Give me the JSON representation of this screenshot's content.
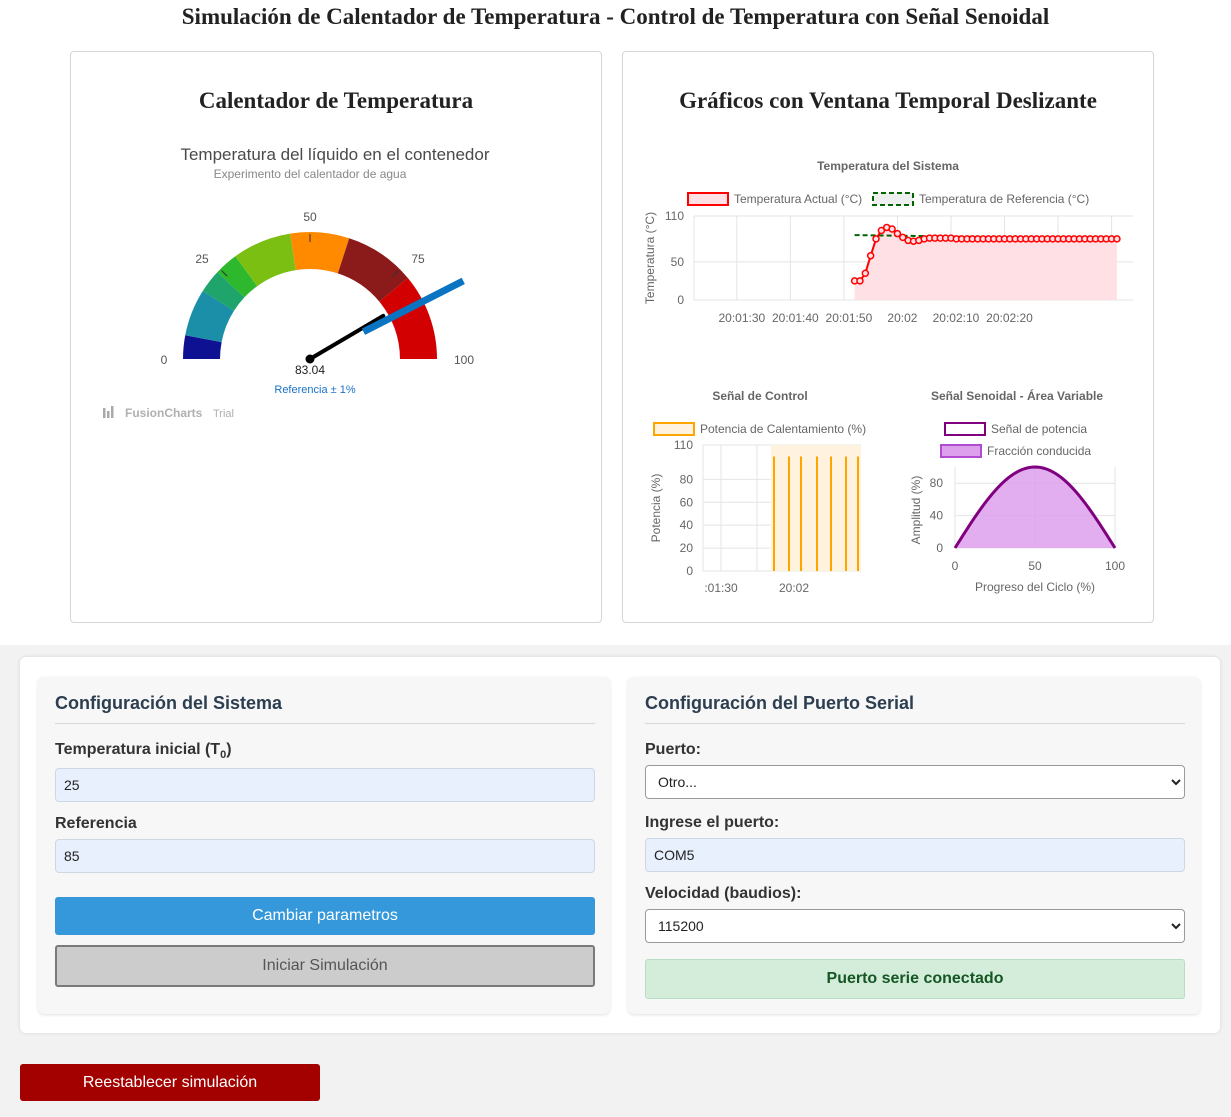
{
  "page": {
    "title": "Simulación de Calentador de Temperatura - Control de Temperatura con Señal Senoidal"
  },
  "left_card": {
    "title": "Calentador de Temperatura",
    "gauge": {
      "caption": "Temperatura del líquido en el contenedor",
      "subcaption": "Experimento del calentador de agua",
      "value": 83.04,
      "value_text": "83.04",
      "reference": 85,
      "reference_text": "Referencia ± 1%",
      "lower_limit": 0,
      "upper_limit": 100,
      "tick_labels": [
        "0",
        "25",
        "50",
        "75",
        "100"
      ],
      "color_bands": [
        {
          "from": 0,
          "to": 6,
          "color": "#0d1192"
        },
        {
          "from": 6,
          "to": 18,
          "color": "#1b8fa8"
        },
        {
          "from": 18,
          "to": 24,
          "color": "#1fa46c"
        },
        {
          "from": 24,
          "to": 30,
          "color": "#2eb82e"
        },
        {
          "from": 30,
          "to": 45,
          "color": "#7cbf13"
        },
        {
          "from": 45,
          "to": 60,
          "color": "#ff8a00"
        },
        {
          "from": 60,
          "to": 78,
          "color": "#8b1a1a"
        },
        {
          "from": 78,
          "to": 100,
          "color": "#d20000"
        }
      ],
      "needle_color": "#000000",
      "reference_marker_color": "#0a74c2",
      "watermark": "FusionCharts",
      "watermark_suffix": "Trial"
    }
  },
  "right_card": {
    "title": "Gráficos con Ventana Temporal Deslizante"
  },
  "chart_data": [
    {
      "type": "line",
      "title": "Temperatura del Sistema",
      "ylabel": "Temperatura (°C)",
      "xlabel": "",
      "ylim": [
        0,
        110
      ],
      "yticks": [
        0,
        50,
        110
      ],
      "x_ticks": [
        "20:01:30",
        "20:01:40",
        "20:01:50",
        "20:02",
        "20:02:10",
        "20:02:20"
      ],
      "x_range_seconds": [
        20,
        102
      ],
      "series": [
        {
          "name": "Temperatura Actual (°C)",
          "color": "#ff0000",
          "fill": "#ffe0e4",
          "x_seconds": [
            50,
            51,
            52,
            53,
            54,
            55,
            56,
            57,
            58,
            59,
            60,
            61,
            62,
            63,
            64,
            65,
            66,
            67,
            68,
            69,
            70,
            71,
            72,
            73,
            74,
            75,
            76,
            77,
            78,
            79,
            80,
            81,
            82,
            83,
            84,
            85,
            86,
            87,
            88,
            89,
            90,
            91,
            92,
            93,
            94,
            95,
            96,
            97,
            98,
            99
          ],
          "values": [
            25,
            25,
            35,
            58,
            80,
            91,
            95,
            93,
            87,
            82,
            78,
            77,
            78,
            80,
            81,
            81,
            81,
            81,
            81,
            80,
            80,
            80,
            80,
            80,
            80,
            80,
            80,
            80,
            80,
            80,
            80,
            80,
            80,
            80,
            80,
            80,
            80,
            80,
            80,
            80,
            80,
            80,
            80,
            80,
            80,
            80,
            80,
            80,
            80,
            80
          ]
        },
        {
          "name": "Temperatura de Referencia (°C)",
          "color": "#006400",
          "dashed": true,
          "x_seconds": [
            50,
            99
          ],
          "values": [
            85,
            80
          ]
        }
      ]
    },
    {
      "type": "bar",
      "title": "Señal de Control",
      "ylabel": "Potencia (%)",
      "ylim": [
        0,
        110
      ],
      "yticks": [
        0,
        20,
        40,
        60,
        80,
        110
      ],
      "x_ticks": [
        ":01:30",
        "20:02"
      ],
      "series": [
        {
          "name": "Potencia de Calentamiento (%)",
          "color": "#ffa500",
          "values": [
            100,
            100,
            100,
            100,
            100,
            100,
            100
          ]
        }
      ]
    },
    {
      "type": "area",
      "title": "Señal Senoidal - Área Variable",
      "xlabel": "Progreso del Ciclo (%)",
      "ylabel": "Amplitud (%)",
      "xlim": [
        0,
        100
      ],
      "ylim": [
        0,
        100
      ],
      "xticks": [
        0,
        50,
        100
      ],
      "yticks": [
        0,
        40,
        80
      ],
      "series": [
        {
          "name": "Señal de potencia",
          "color": "#800080",
          "x": [
            0,
            10,
            20,
            30,
            40,
            50,
            60,
            70,
            80,
            90,
            100
          ],
          "values": [
            0,
            31,
            59,
            81,
            95,
            100,
            95,
            81,
            59,
            31,
            0
          ]
        },
        {
          "name": "Fracción conducida",
          "color": "#dda0ec",
          "x": [
            0,
            10,
            20,
            30,
            40,
            50,
            60,
            70,
            80,
            90,
            100
          ],
          "values": [
            0,
            31,
            59,
            81,
            95,
            100,
            95,
            81,
            59,
            31,
            0
          ]
        }
      ]
    }
  ],
  "system_config": {
    "title": "Configuración del Sistema",
    "initial_temp_label": "Temperatura inicial (T",
    "initial_temp_sub": "0",
    "initial_temp_close": ")",
    "initial_temp_value": "25",
    "reference_label": "Referencia",
    "reference_value": "85",
    "change_button": "Cambiar parametros",
    "start_button": "Iniciar Simulación"
  },
  "serial_config": {
    "title": "Configuración del Puerto Serial",
    "port_label": "Puerto:",
    "port_selected": "Otro...",
    "port_input_label": "Ingrese el puerto:",
    "port_input_value": "COM5",
    "baud_label": "Velocidad (baudios):",
    "baud_selected": "115200",
    "status": "Puerto serie conectado"
  },
  "reset_button": "Reestablecer simulación"
}
